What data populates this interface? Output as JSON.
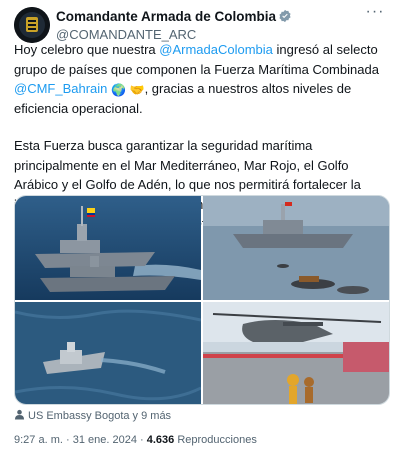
{
  "account": {
    "display_name": "Comandante Armada de Colombia",
    "handle": "@COMANDANTE_ARC"
  },
  "tweet": {
    "p1_a": "Hoy celebro que nuestra ",
    "mention_armada": "@ArmadaColombia",
    "p1_b": " ingresó al selecto grupo de países que componen la Fuerza Marítima Combinada ",
    "mention_cmf": "@CMF_Bahrain",
    "p1_c": ", gracias a nuestros altos niveles de eficiencia operacional.",
    "p2": "Esta Fuerza busca garantizar la seguridad marítima principalmente en el Mar Mediterráneo, Mar Rojo, el Golfo Arábico y el Golfo de Adén, lo que nos permitirá fortalecer la interoperabilidad, intercambiar mejores prácticas y ampliar la cooperación multilateral en beneficio de Colombia",
    "emoji_globe": "🌍",
    "emoji_handshake": "🤝"
  },
  "tagged": "US Embassy Bogota y 9 más",
  "meta": {
    "time": "9:27 a. m.",
    "separator": "·",
    "date": "31 ene. 2024",
    "views_count": "4.636",
    "views_label": "Reproducciones"
  },
  "colors": {
    "link": "#1d9bf0",
    "secondary_text": "#536471",
    "primary_text": "#0f1419",
    "flag": [
      "#fcd116",
      "#003893",
      "#ce1126"
    ]
  },
  "icons": [
    "verified-badge-icon",
    "more-options-icon",
    "person-tag-icon",
    "globe-emoji-icon",
    "handshake-emoji-icon",
    "colombia-flag-icon"
  ]
}
